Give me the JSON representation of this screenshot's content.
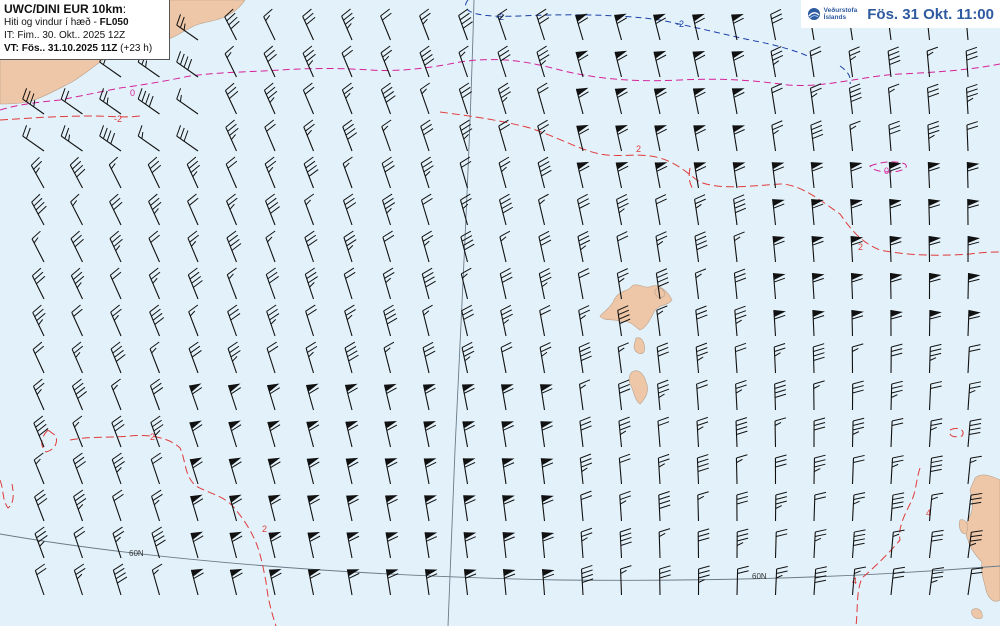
{
  "info": {
    "model": "UWC/DINI EUR 10km",
    "parameter": "Hiti og vindur í hæð - ",
    "level": "FL050",
    "issue_time": "IT: Fim.. 30. Okt.. 2025 12Z",
    "valid_line_bold": "VT: Fös.. 31.10.2025 11Z",
    "valid_line_rest": " (+23 h)"
  },
  "valid_time": "Fös. 31 Okt. 11:00",
  "logo": {
    "line1": "Veðurstofa",
    "line2": "Íslands",
    "icon": "vedurstofa-logo-icon"
  },
  "map": {
    "contour_labels": [
      {
        "text": "-2",
        "color": "#1a3fa8"
      },
      {
        "text": "-2",
        "color": "#1a3fa8"
      },
      {
        "text": "0",
        "color": "#d6209a"
      },
      {
        "text": "0",
        "color": "#d6209a"
      },
      {
        "text": "-2",
        "color": "#e03a3a"
      },
      {
        "text": "2",
        "color": "#e03a3a"
      },
      {
        "text": "2",
        "color": "#e03a3a"
      },
      {
        "text": "2",
        "color": "#e03a3a"
      },
      {
        "text": "2",
        "color": "#e03a3a"
      },
      {
        "text": "4",
        "color": "#e03a3a"
      },
      {
        "text": "4",
        "color": "#e03a3a"
      }
    ],
    "latitude_labels": [
      "60N",
      "60N"
    ]
  },
  "colors": {
    "sea": "#e3f2fa",
    "land": "#eec7a8",
    "contour_cold": "#1a3fa8",
    "contour_zero": "#d6209a",
    "contour_warm": "#e03a3a",
    "barb": "#111111",
    "accent": "#2e5aa0"
  }
}
